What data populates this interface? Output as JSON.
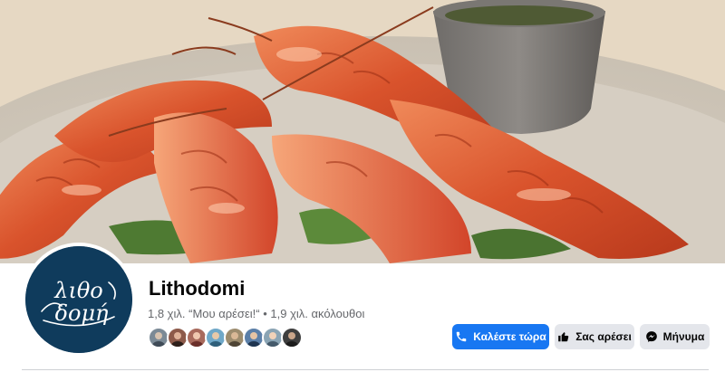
{
  "page": {
    "name": "Lithodomi",
    "likes": "1,8 χιλ. “Μου αρέσει!“",
    "separator": "•",
    "followers": "1,9 χιλ. ακόλουθοι"
  },
  "logo": {
    "text_line1": "λιθο",
    "text_line2": "δομή",
    "background": "#0f3b5c"
  },
  "friends": [
    {
      "name": "friend-avatar-1",
      "color": "#7b8a96"
    },
    {
      "name": "friend-avatar-2",
      "color": "#8d5a4a"
    },
    {
      "name": "friend-avatar-3",
      "color": "#a86a5c"
    },
    {
      "name": "friend-avatar-4",
      "color": "#6fa8c8"
    },
    {
      "name": "friend-avatar-5",
      "color": "#9c8c6e"
    },
    {
      "name": "friend-avatar-6",
      "color": "#5b7fa8"
    },
    {
      "name": "friend-avatar-7",
      "color": "#8aa4b4"
    },
    {
      "name": "friend-avatar-8",
      "color": "#3e3e3e"
    }
  ],
  "actions": {
    "call_label": "Καλέστε τώρα",
    "like_label": "Σας αρέσει",
    "message_label": "Μήνυμα"
  },
  "colors": {
    "primary": "#1877f2",
    "secondary_button": "#e4e6eb",
    "text": "#050505",
    "muted_text": "#65676b"
  },
  "icons": {
    "call": "phone-icon",
    "like": "thumbs-up-icon",
    "message": "messenger-icon"
  }
}
